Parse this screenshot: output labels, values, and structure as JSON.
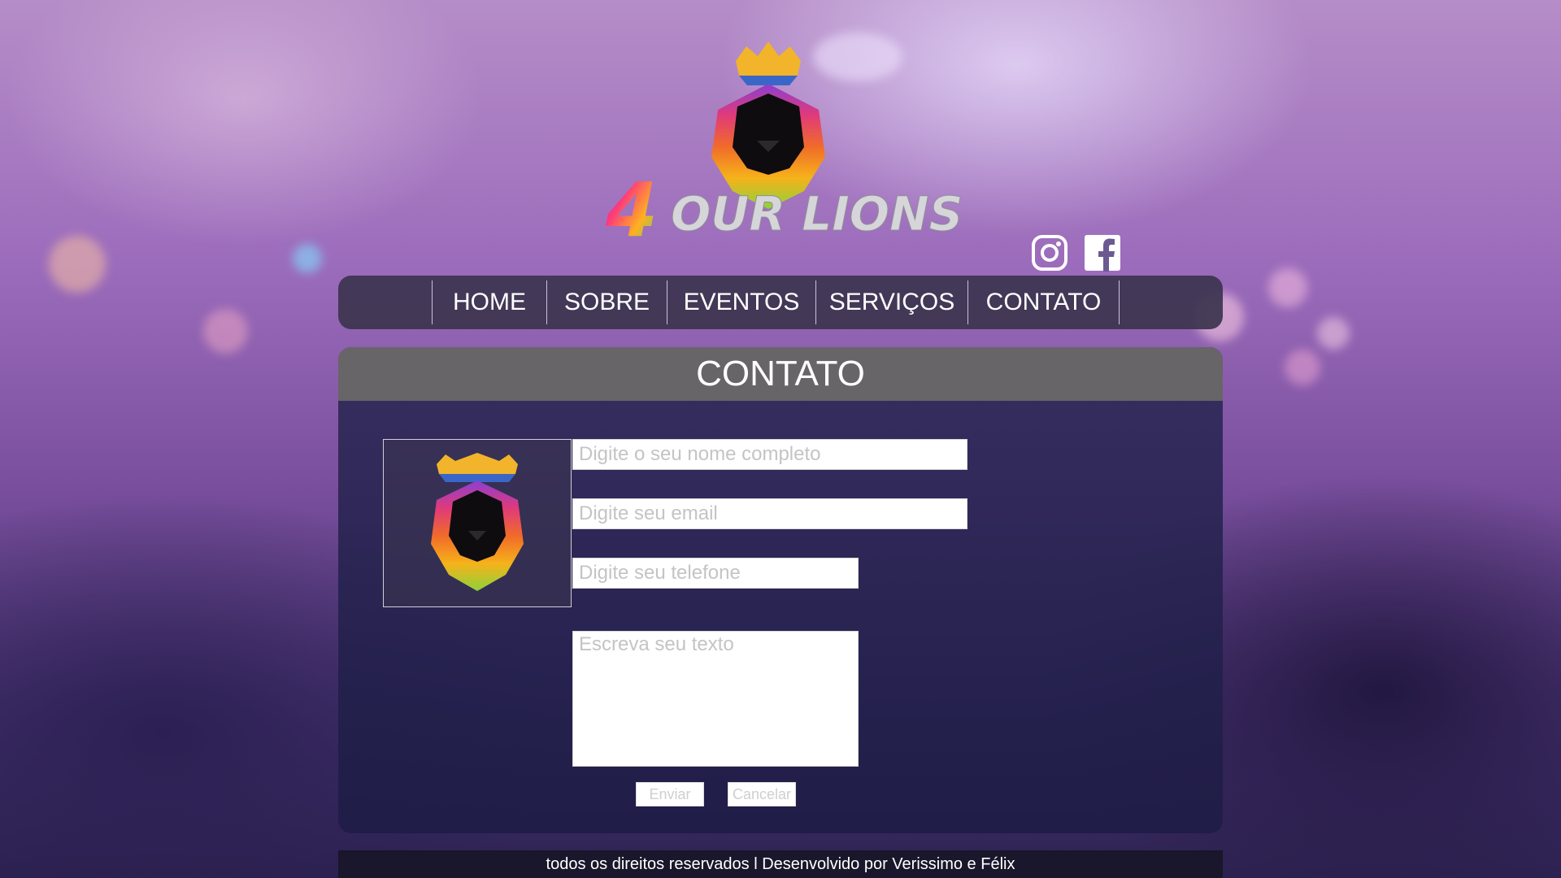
{
  "brand": {
    "wordmark": "4OUR LIONS"
  },
  "social": {
    "instagram_icon": "instagram-icon",
    "facebook_icon": "facebook-icon"
  },
  "nav": {
    "items": [
      {
        "label": "HOME"
      },
      {
        "label": "SOBRE"
      },
      {
        "label": "EVENTOS"
      },
      {
        "label": "SERVIÇOS"
      },
      {
        "label": "CONTATO"
      }
    ]
  },
  "contact": {
    "title": "CONTATO",
    "name_placeholder": "Digite o seu nome completo",
    "email_placeholder": "Digite seu email",
    "phone_placeholder": "Digite seu telefone",
    "message_placeholder": "Escreva seu texto",
    "submit_label": "Enviar",
    "cancel_label": "Cancelar"
  },
  "footer": {
    "text": "todos os direitos reservados l Desenvolvido por Verissimo e Félix"
  },
  "colors": {
    "nav_bg": "#3c344e",
    "panel_head": "#686568",
    "text": "#ffffff"
  }
}
